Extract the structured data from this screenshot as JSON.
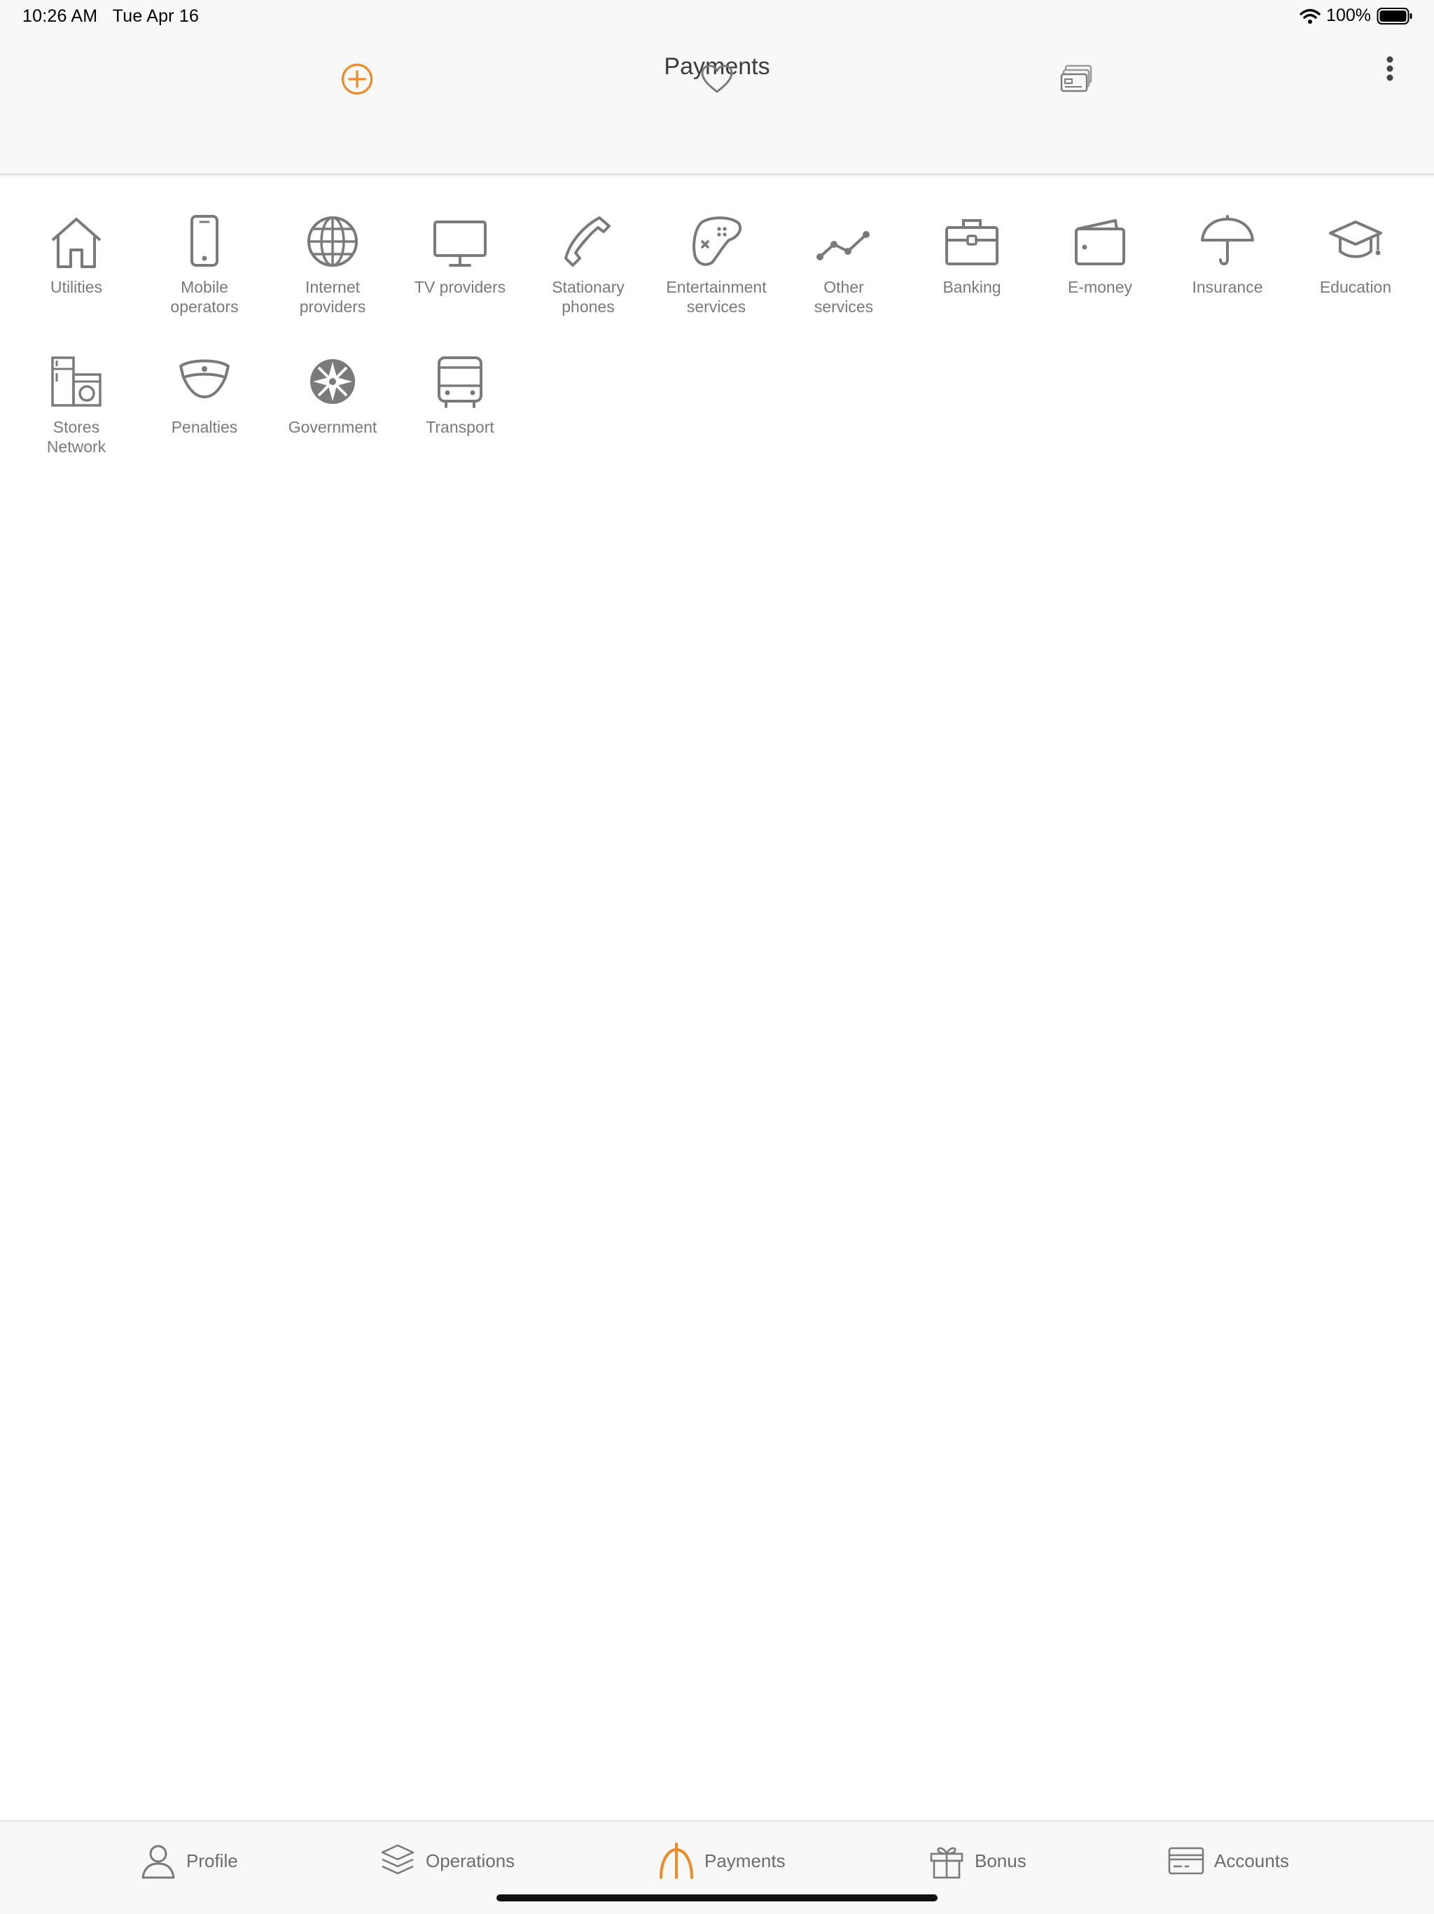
{
  "status_bar": {
    "time": "10:26 AM",
    "date": "Tue Apr 16",
    "battery": "100%",
    "icons": [
      "wifi-icon",
      "battery-icon"
    ]
  },
  "header": {
    "title": "Payments",
    "tabs": [
      {
        "name": "new-payment",
        "icon": "plus-circle-icon",
        "active": true
      },
      {
        "name": "favorites",
        "icon": "heart-icon",
        "active": false
      },
      {
        "name": "templates",
        "icon": "cards-icon",
        "active": false
      }
    ]
  },
  "categories": [
    {
      "label": "Utilities",
      "icon": "house-icon"
    },
    {
      "label": "Mobile\noperators",
      "icon": "phone-icon"
    },
    {
      "label": "Internet\nproviders",
      "icon": "globe-icon"
    },
    {
      "label": "TV providers",
      "icon": "monitor-icon"
    },
    {
      "label": "Stationary\nphones",
      "icon": "handset-icon"
    },
    {
      "label": "Entertainment\nservices",
      "icon": "gamepad-icon"
    },
    {
      "label": "Other\nservices",
      "icon": "line-chart-icon"
    },
    {
      "label": "Banking",
      "icon": "briefcase-icon"
    },
    {
      "label": "E-money",
      "icon": "wallet-icon"
    },
    {
      "label": "Insurance",
      "icon": "umbrella-icon"
    },
    {
      "label": "Education",
      "icon": "graduation-cap-icon"
    },
    {
      "label": "Stores\nNetwork",
      "icon": "appliances-icon"
    },
    {
      "label": "Penalties",
      "icon": "police-cap-icon"
    },
    {
      "label": "Government",
      "icon": "emblem-icon"
    },
    {
      "label": "Transport",
      "icon": "bus-icon"
    }
  ],
  "tabbar": [
    {
      "label": "Profile",
      "icon": "person-icon",
      "active": false
    },
    {
      "label": "Operations",
      "icon": "layers-icon",
      "active": false
    },
    {
      "label": "Payments",
      "icon": "manat-icon",
      "active": true
    },
    {
      "label": "Bonus",
      "icon": "gift-icon",
      "active": false
    },
    {
      "label": "Accounts",
      "icon": "card-icon",
      "active": false
    }
  ],
  "colors": {
    "accent": "#f08a24",
    "icon_gray": "#7a7a7a",
    "bar_bg": "#f8f8f8"
  }
}
